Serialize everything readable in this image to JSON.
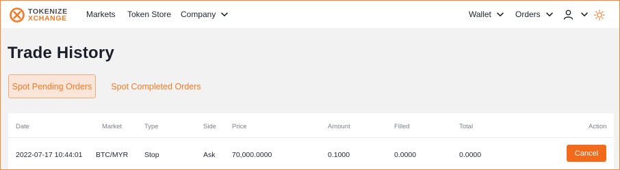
{
  "brand": {
    "line1": "TOKENIZE",
    "line2": "XCHANGE"
  },
  "nav": {
    "markets": "Markets",
    "token_store": "Token Store",
    "company": "Company",
    "wallet": "Wallet",
    "orders": "Orders"
  },
  "page": {
    "title": "Trade History",
    "tabs": [
      "Spot Pending Orders",
      "Spot Completed Orders"
    ],
    "active_tab": "Spot Pending Orders"
  },
  "table": {
    "columns": [
      "Date",
      "Market",
      "Type",
      "Side",
      "Price",
      "Amount",
      "Filled",
      "Total",
      "Action"
    ],
    "rows": [
      {
        "date": "2022-07-17 10:44:01",
        "market": "BTC/MYR",
        "type": "Stop",
        "side": "Ask",
        "price": "70,000.0000",
        "amount": "0.1000",
        "filled": "0.0000",
        "total": "0.0000",
        "action": "Cancel"
      }
    ]
  },
  "colors": {
    "accent": "#f27a27",
    "button": "#f26a1b",
    "active_tab_bg": "#fbe5d9",
    "border": "#f08a3c",
    "page_bg": "#f2f2f3"
  },
  "icons": [
    "tokenize-logo-icon",
    "chevron-down-icon",
    "user-icon",
    "sun-icon"
  ]
}
